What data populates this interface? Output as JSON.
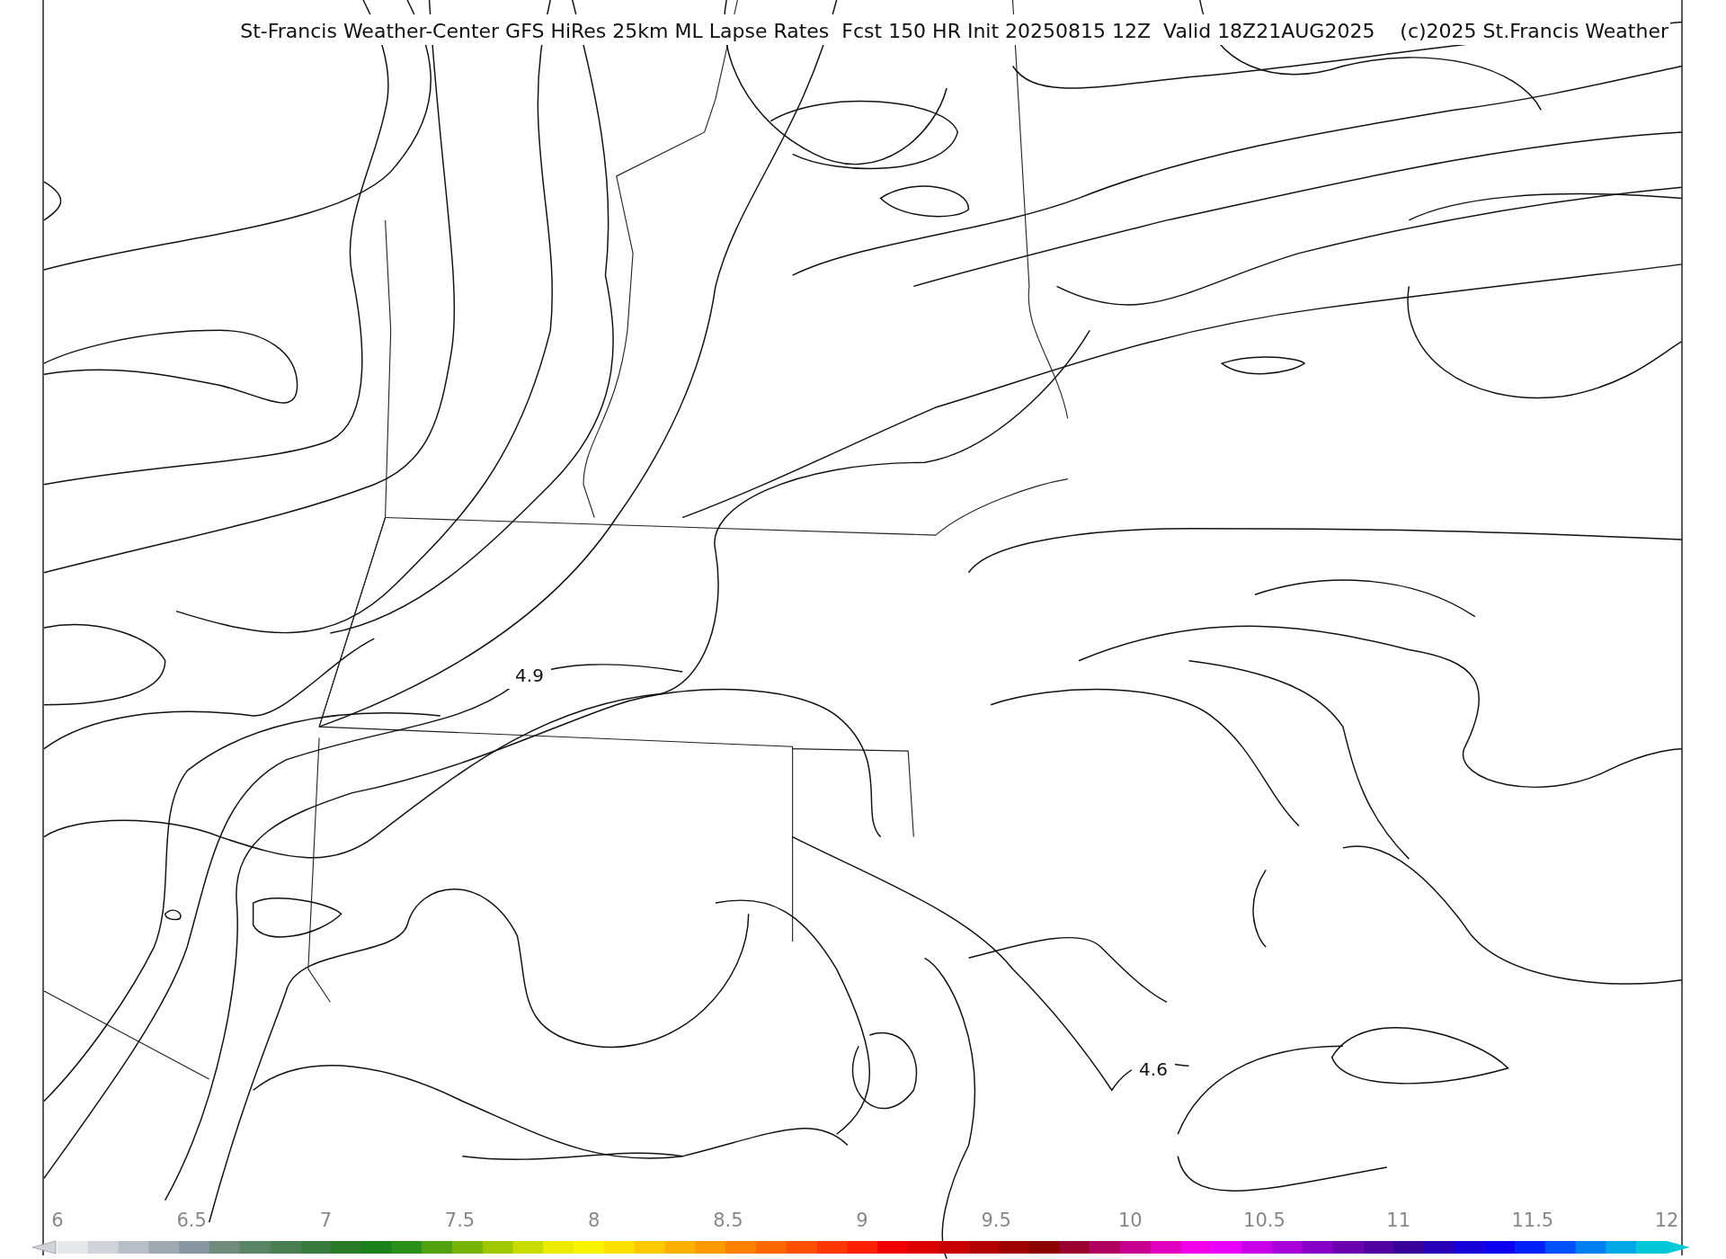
{
  "map": {
    "title": "St-Francis Weather-Center GFS HiRes 25km ML Lapse Rates  Fcst 150 HR Init 20250815 12Z  Valid 18Z21AUG2025    (c)2025 St.Francis Weather",
    "contour_labels": [
      "4.9",
      "4.6"
    ]
  },
  "colorbar": {
    "ticks": [
      "6",
      "6.5",
      "7",
      "7.5",
      "8",
      "8.5",
      "9",
      "9.5",
      "10",
      "10.5",
      "11",
      "11.5",
      "12"
    ]
  }
}
